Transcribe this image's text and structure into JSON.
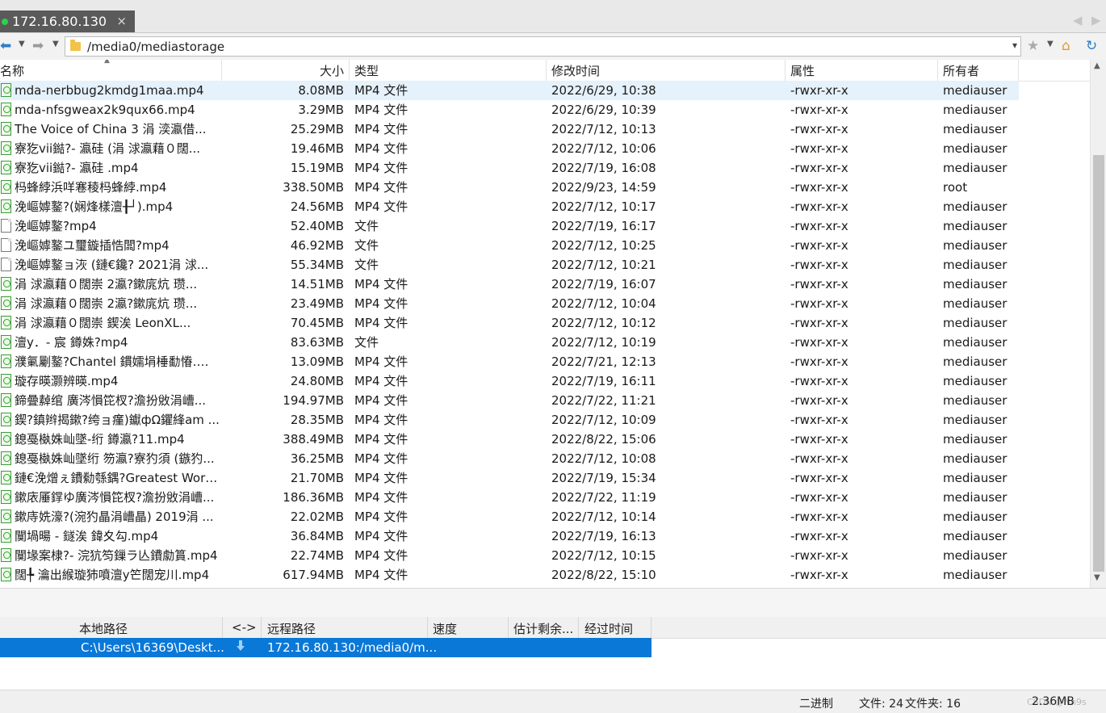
{
  "tab": {
    "title": "172.16.80.130",
    "close": "×",
    "prev": "◀",
    "next": "▶"
  },
  "toolbar": {
    "back_icon": "back-arrow-icon",
    "forward_icon": "forward-arrow-icon",
    "path": "/media0/mediastorage",
    "path_dropdown": "⌄"
  },
  "file_table": {
    "headers": {
      "name": "名称",
      "size": "大小",
      "type": "类型",
      "modified": "修改时间",
      "attributes": "属性",
      "owner": "所有者"
    },
    "rows": [
      {
        "icon": "mp4",
        "name": "mda-nerbbug2kmdg1maa.mp4",
        "size": "8.08MB",
        "type": "MP4 文件",
        "modified": "2022/6/29, 10:38",
        "attr": "-rwxr-xr-x",
        "owner": "mediauser"
      },
      {
        "icon": "mp4",
        "name": "mda-nfsgweax2k9qux66.mp4",
        "size": "3.29MB",
        "type": "MP4 文件",
        "modified": "2022/6/29, 10:39",
        "attr": "-rwxr-xr-x",
        "owner": "mediauser"
      },
      {
        "icon": "mp4",
        "name": "The Voice of China 3 涓   湙瀛借...",
        "size": "25.29MB",
        "type": "MP4 文件",
        "modified": "2022/7/12, 10:13",
        "attr": "-rwxr-xr-x",
        "owner": "mediauser"
      },
      {
        "icon": "mp4",
        "name": "寮犵vii鐑?- 瀛硅    (涓    浗瀛藉０闊...",
        "size": "19.46MB",
        "type": "MP4 文件",
        "modified": "2022/7/12, 10:06",
        "attr": "-rwxr-xr-x",
        "owner": "mediauser"
      },
      {
        "icon": "mp4",
        "name": "寮犵vii鐑?- 瀛硅    .mp4",
        "size": "15.19MB",
        "type": "MP4 文件",
        "modified": "2022/7/19, 16:08",
        "attr": "-rwxr-xr-x",
        "owner": "mediauser"
      },
      {
        "icon": "mp4",
        "name": "杩蜂綍浜咩寋稜杩蜂綍.mp4",
        "size": "338.50MB",
        "type": "MP4 文件",
        "modified": "2022/9/23, 14:59",
        "attr": "-rwxr-xr-x",
        "owner": "root"
      },
      {
        "icon": "mp4",
        "name": "浼嶇嫭鐜?(娴烽樣澶╂┘).mp4",
        "size": "24.56MB",
        "type": "MP4 文件",
        "modified": "2022/7/12, 10:17",
        "attr": "-rwxr-xr-x",
        "owner": "mediauser"
      },
      {
        "icon": "plain",
        "name": "浼嶇嫭鐜?mp4",
        "size": "52.40MB",
        "type": "文件",
        "modified": "2022/7/19, 16:17",
        "attr": "-rwxr-xr-x",
        "owner": "mediauser"
      },
      {
        "icon": "plain",
        "name": "浼嶇嫭鐜ユ璽鏇插悎闆?mp4",
        "size": "46.92MB",
        "type": "文件",
        "modified": "2022/7/12, 10:25",
        "attr": "-rwxr-xr-x",
        "owner": "mediauser"
      },
      {
        "icon": "plain",
        "name": "浼嶇嫭鐜ョ洃 (鏈€鑱? 2021涓    浗...",
        "size": "55.34MB",
        "type": "文件",
        "modified": "2022/7/12, 10:21",
        "attr": "-rwxr-xr-x",
        "owner": "mediauser"
      },
      {
        "icon": "mp4",
        "name": "涓    浗瀛藉０闊崇    2瀛?鏉庣炕 瓒...",
        "size": "14.51MB",
        "type": "MP4 文件",
        "modified": "2022/7/19, 16:07",
        "attr": "-rwxr-xr-x",
        "owner": "mediauser"
      },
      {
        "icon": "mp4",
        "name": "涓    浗瀛藉０闊崇    2瀛?鏉庣炕 瓒...",
        "size": "23.49MB",
        "type": "MP4 文件",
        "modified": "2022/7/12, 10:04",
        "attr": "-rwxr-xr-x",
        "owner": "mediauser"
      },
      {
        "icon": "mp4",
        "name": "涓    浗瀛藉０闊崇    鍥涘    LeonXL...",
        "size": "70.45MB",
        "type": "MP4 文件",
        "modified": "2022/7/12, 10:12",
        "attr": "-rwxr-xr-x",
        "owner": "mediauser"
      },
      {
        "icon": "mp4",
        "name": "澶у．- 宸    鐏姝?mp4",
        "size": "83.63MB",
        "type": "文件",
        "modified": "2022/7/12, 10:19",
        "attr": "-rwxr-xr-x",
        "owner": "mediauser"
      },
      {
        "icon": "mp4",
        "name": "濮氭劚鐜?Chantel 鏆嬬埍棰勫慻.mp4",
        "size": "13.09MB",
        "type": "MP4 文件",
        "modified": "2022/7/21, 12:13",
        "attr": "-rwxr-xr-x",
        "owner": "mediauser"
      },
      {
        "icon": "mp4",
        "name": "璇存暎灏辨暎.mp4",
        "size": "24.80MB",
        "type": "MP4 文件",
        "modified": "2022/7/19, 16:11",
        "attr": "-rwxr-xr-x",
        "owner": "mediauser"
      },
      {
        "icon": "mp4",
        "name": "鍗曡繛绾    廣涔愪笓杈?澹扮敓涓嶆...",
        "size": "194.97MB",
        "type": "MP4 文件",
        "modified": "2022/7/22, 11:21",
        "attr": "-rwxr-xr-x",
        "owner": "mediauser"
      },
      {
        "icon": "mp4",
        "name": "鍥?鎮辫揭鏉?绔ョ瘽)钀фΩ鑺綘am ...",
        "size": "28.35MB",
        "type": "MP4 文件",
        "modified": "2022/7/12, 10:09",
        "attr": "-rwxr-xr-x",
        "owner": "mediauser"
      },
      {
        "icon": "mp4",
        "name": "鎴戞槸姝屾墜-绗    鐏瀛?11.mp4",
        "size": "388.49MB",
        "type": "MP4 文件",
        "modified": "2022/8/22, 15:06",
        "attr": "-rwxr-xr-x",
        "owner": "mediauser"
      },
      {
        "icon": "mp4",
        "name": "鎴戞槸姝屾墜绗    笏瀛?寮犳須 (鏃犳...",
        "size": "36.25MB",
        "type": "MP4 文件",
        "modified": "2022/7/12, 10:08",
        "attr": "-rwxr-xr-x",
        "owner": "mediauser"
      },
      {
        "icon": "mp4",
        "name": "鏈€浼熷ぇ鐨勬綔鍝?Greatest Work...",
        "size": "21.70MB",
        "type": "MP4 文件",
        "modified": "2022/7/19, 15:34",
        "attr": "-rwxr-xr-x",
        "owner": "mediauser"
      },
      {
        "icon": "mp4",
        "name": "鏉庡厜鐣ゆ廣涔愪笓杈?澹扮敓涓嶆...",
        "size": "186.36MB",
        "type": "MP4 文件",
        "modified": "2022/7/22, 11:19",
        "attr": "-rwxr-xr-x",
        "owner": "mediauser"
      },
      {
        "icon": "mp4",
        "name": "鏉庤姺濠?(涴犳瞐涓嶆瞐) 2019涓    ...",
        "size": "22.02MB",
        "type": "MP4 文件",
        "modified": "2022/7/12, 10:14",
        "attr": "-rwxr-xr-x",
        "owner": "mediauser"
      },
      {
        "icon": "mp4",
        "name": "闃堝暘 - 鐩涘    鍏夊勾.mp4",
        "size": "36.84MB",
        "type": "MP4 文件",
        "modified": "2022/7/19, 16:13",
        "attr": "-rwxr-xr-x",
        "owner": "mediauser"
      },
      {
        "icon": "mp4",
        "name": "闃堟案棣?- 浣犺笉鏁ラ亾鐨勮篔.mp4",
        "size": "22.74MB",
        "type": "MP4 文件",
        "modified": "2022/7/12, 10:15",
        "attr": "-rwxr-xr-x",
        "owner": "mediauser"
      },
      {
        "icon": "mp4",
        "name": "闊╄    瀹出緱璇犻噴澶у笀闊宠川.mp4",
        "size": "617.94MB",
        "type": "MP4 文件",
        "modified": "2022/8/22, 15:10",
        "attr": "-rwxr-xr-x",
        "owner": "mediauser"
      }
    ]
  },
  "queue": {
    "headers": {
      "local": "本地路径",
      "direction": "<->",
      "remote": "远程路径",
      "speed": "速度",
      "eta": "估计剩余...",
      "elapsed": "经过时间"
    },
    "rows": [
      {
        "local": "C:\\Users\\16369\\Deskt...",
        "direction_icon": "download-arrow-icon",
        "remote": "172.16.80.130:/media0/m..."
      }
    ]
  },
  "status": {
    "mode": "二进制",
    "files": "文件: 24",
    "folders": "文件夹: 16",
    "size": "2.36MB",
    "watermark": "CSDN @Nn9s"
  },
  "colors": {
    "tab_bg": "#5a5a5a",
    "selected_row": "#e5f1fb",
    "queue_selected": "#0a78d7",
    "connected_dot": "#2bd24b"
  }
}
